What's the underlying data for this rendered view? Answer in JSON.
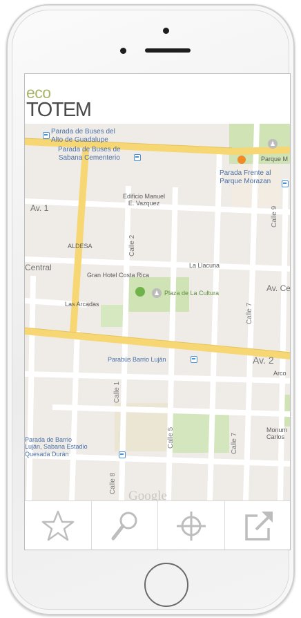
{
  "app": {
    "logo_eco": "eco",
    "logo_totem": "TOTEM"
  },
  "map": {
    "labels": {
      "bus_stop_guadalupe": "Parada de Buses del\nAlto de Guadalupe",
      "bus_stop_sabana": "Parada de Buses de\nSabana Cementerio",
      "parque_m": "Parque M",
      "parada_frente_parque": "Parada Frente al\nParque Morazan",
      "edificio_manuel": "Edificio Manuel\nE. Vazquez",
      "av_1": "Av. 1",
      "calle_9": "Calle 9",
      "aldesa": "ALDESA",
      "calle_2": "Calle 2",
      "central": "Central",
      "la_llacuna": "La Llacuna",
      "gran_hotel": "Gran Hotel Costa Rica",
      "plaza_cultura": "Plaza de La Cultura",
      "av_central_right": "Av. Ce",
      "las_arcadas": "Las Arcadas",
      "calle_7_upper": "Calle 7",
      "parabus": "Parabús Barrio Luján",
      "av_2": "Av. 2",
      "arco": "Arco",
      "calle_1": "Calle 1",
      "calle_5": "Calle 5",
      "calle_7_lower": "Calle 7",
      "parada_barrio": "Parada de Barrio\nLuján, Sabana Estadio\nQuesada Durán",
      "monumento": "Monum\nCarlos",
      "calle_8": "Calle 8",
      "google": "Google"
    },
    "colors": {
      "land": "#efece7",
      "street": "#ffffff",
      "arterial": "#f7d774",
      "park": "#cfe3b5"
    }
  },
  "toolbar": {
    "items": [
      {
        "name": "favorites",
        "icon": "star-icon"
      },
      {
        "name": "search",
        "icon": "magnifier-icon"
      },
      {
        "name": "locate",
        "icon": "crosshair-icon"
      },
      {
        "name": "share",
        "icon": "external-link-icon"
      }
    ]
  }
}
